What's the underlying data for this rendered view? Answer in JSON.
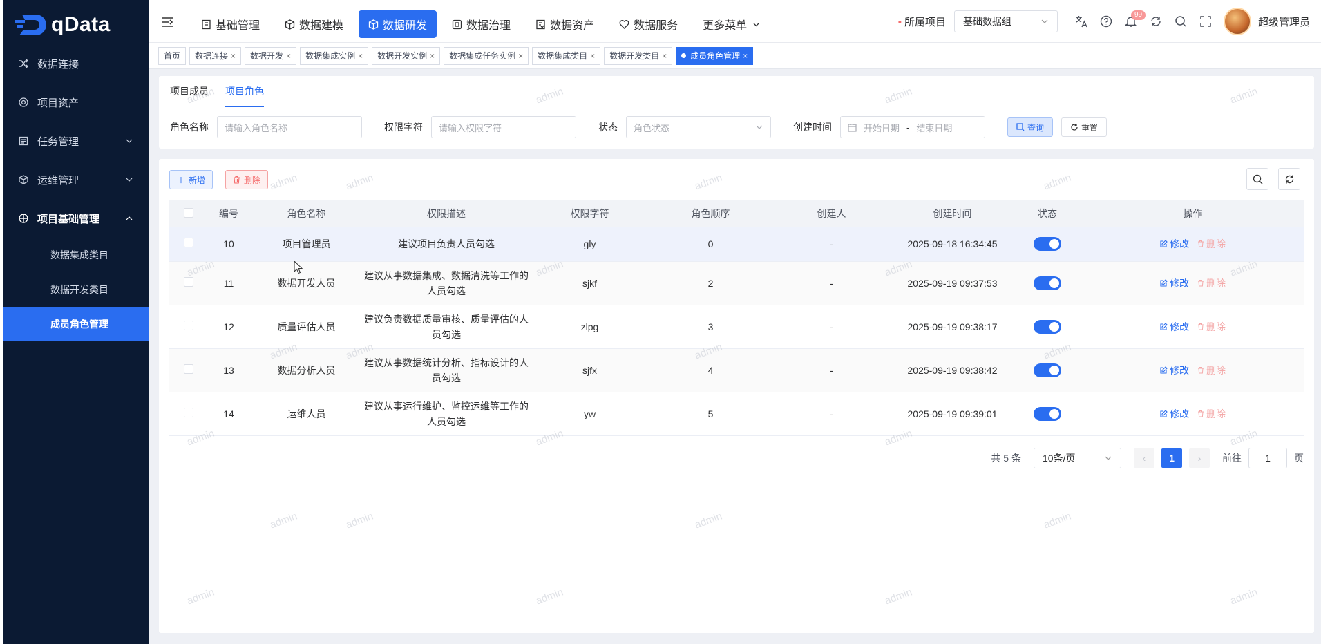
{
  "app": {
    "logo_text": "qData"
  },
  "sidebar": {
    "items": [
      {
        "label": "数据连接",
        "icon": "shuffle-icon"
      },
      {
        "label": "项目资产",
        "icon": "target-icon"
      },
      {
        "label": "任务管理",
        "icon": "list-icon",
        "expandable": true
      },
      {
        "label": "运维管理",
        "icon": "cube-icon",
        "expandable": true
      },
      {
        "label": "项目基础管理",
        "icon": "grid-circle-icon",
        "expanded": true
      }
    ],
    "subitems": [
      {
        "label": "数据集成类目"
      },
      {
        "label": "数据开发类目"
      },
      {
        "label": "成员角色管理",
        "active": true
      }
    ]
  },
  "topnav": {
    "items": [
      {
        "label": "基础管理"
      },
      {
        "label": "数据建模"
      },
      {
        "label": "数据研发",
        "active": true
      },
      {
        "label": "数据治理"
      },
      {
        "label": "数据资产"
      },
      {
        "label": "数据服务"
      },
      {
        "label": "更多菜单"
      }
    ],
    "project_label": "所属项目",
    "project_value": "基础数据组",
    "notification_count": "99",
    "username": "超级管理员"
  },
  "tags": [
    {
      "label": "首页"
    },
    {
      "label": "数据连接"
    },
    {
      "label": "数据开发"
    },
    {
      "label": "数据集成实例"
    },
    {
      "label": "数据开发实例"
    },
    {
      "label": "数据集成任务实例"
    },
    {
      "label": "数据集成类目"
    },
    {
      "label": "数据开发类目"
    },
    {
      "label": "成员角色管理",
      "active": true
    }
  ],
  "tabs": [
    {
      "label": "项目成员"
    },
    {
      "label": "项目角色",
      "active": true
    }
  ],
  "filters": {
    "role_name_label": "角色名称",
    "role_name_placeholder": "请输入角色名称",
    "perm_label": "权限字符",
    "perm_placeholder": "请输入权限字符",
    "status_label": "状态",
    "status_placeholder": "角色状态",
    "created_label": "创建时间",
    "start_placeholder": "开始日期",
    "range_sep": "-",
    "end_placeholder": "结束日期",
    "query_label": "查询",
    "reset_label": "重置"
  },
  "toolbar": {
    "add_label": "新增",
    "delete_label": "删除"
  },
  "table": {
    "headers": [
      "编号",
      "角色名称",
      "权限描述",
      "权限字符",
      "角色顺序",
      "创建人",
      "创建时间",
      "状态",
      "操作"
    ],
    "rows": [
      {
        "id": "10",
        "name": "项目管理员",
        "desc": "建议项目负责人员勾选",
        "perm": "gly",
        "order": "0",
        "creator": "-",
        "created": "2025-09-18 16:34:45",
        "enabled": true
      },
      {
        "id": "11",
        "name": "数据开发人员",
        "desc": "建议从事数据集成、数据清洗等工作的人员勾选",
        "perm": "sjkf",
        "order": "2",
        "creator": "-",
        "created": "2025-09-19 09:37:53",
        "enabled": true
      },
      {
        "id": "12",
        "name": "质量评估人员",
        "desc": "建议负责数据质量审核、质量评估的人员勾选",
        "perm": "zlpg",
        "order": "3",
        "creator": "-",
        "created": "2025-09-19 09:38:17",
        "enabled": true
      },
      {
        "id": "13",
        "name": "数据分析人员",
        "desc": "建议从事数据统计分析、指标设计的人员勾选",
        "perm": "sjfx",
        "order": "4",
        "creator": "-",
        "created": "2025-09-19 09:38:42",
        "enabled": true
      },
      {
        "id": "14",
        "name": "运维人员",
        "desc": "建议从事运行维护、监控运维等工作的人员勾选",
        "perm": "yw",
        "order": "5",
        "creator": "-",
        "created": "2025-09-19 09:39:01",
        "enabled": true
      }
    ],
    "edit_label": "修改",
    "delete_label": "删除"
  },
  "pagination": {
    "total_text": "共 5 条",
    "page_size": "10条/页",
    "current_page": "1",
    "goto_label": "前往",
    "goto_value": "1",
    "page_suffix": "页"
  },
  "watermark": "admin",
  "colors": {
    "accent": "#2a6df0",
    "sidebar_bg": "#0b1a33",
    "danger": "#f56c6c"
  }
}
